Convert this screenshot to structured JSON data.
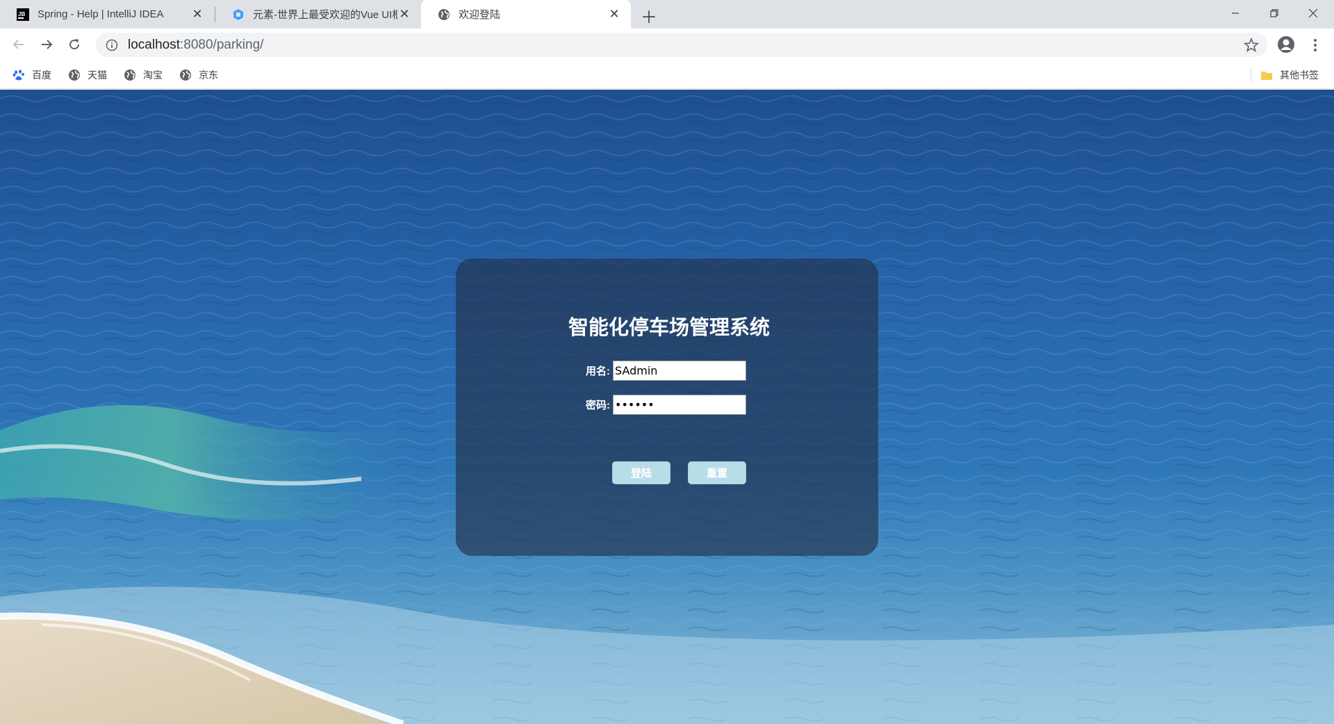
{
  "browser": {
    "tabs": [
      {
        "title": "Spring - Help | IntelliJ IDEA",
        "icon": "intellij-icon"
      },
      {
        "title": "元素-世界上最受欢迎的Vue UI框",
        "icon": "element-ui-icon"
      },
      {
        "title": "欢迎登陆",
        "icon": "globe-icon",
        "active": true
      }
    ],
    "url_host": "localhost",
    "url_rest": ":8080/parking/",
    "bookmarks": [
      {
        "label": "百度",
        "icon": "baidu-paw-icon"
      },
      {
        "label": "天猫",
        "icon": "globe-icon"
      },
      {
        "label": "淘宝",
        "icon": "globe-icon"
      },
      {
        "label": "京东",
        "icon": "globe-icon"
      }
    ],
    "other_bookmarks": "其他书签"
  },
  "login": {
    "title": "智能化停车场管理系统",
    "username_label": "用名:",
    "username_value": "SAdmin",
    "password_label": "密码:",
    "password_value": "123456",
    "login_button": "登陆",
    "reset_button": "重置"
  },
  "colors": {
    "tabstrip": "#dee1e6",
    "panel_overlay": "rgba(35,52,78,0.68)",
    "button_bg": "#b9dde8",
    "sea": "#1f5fa0"
  }
}
